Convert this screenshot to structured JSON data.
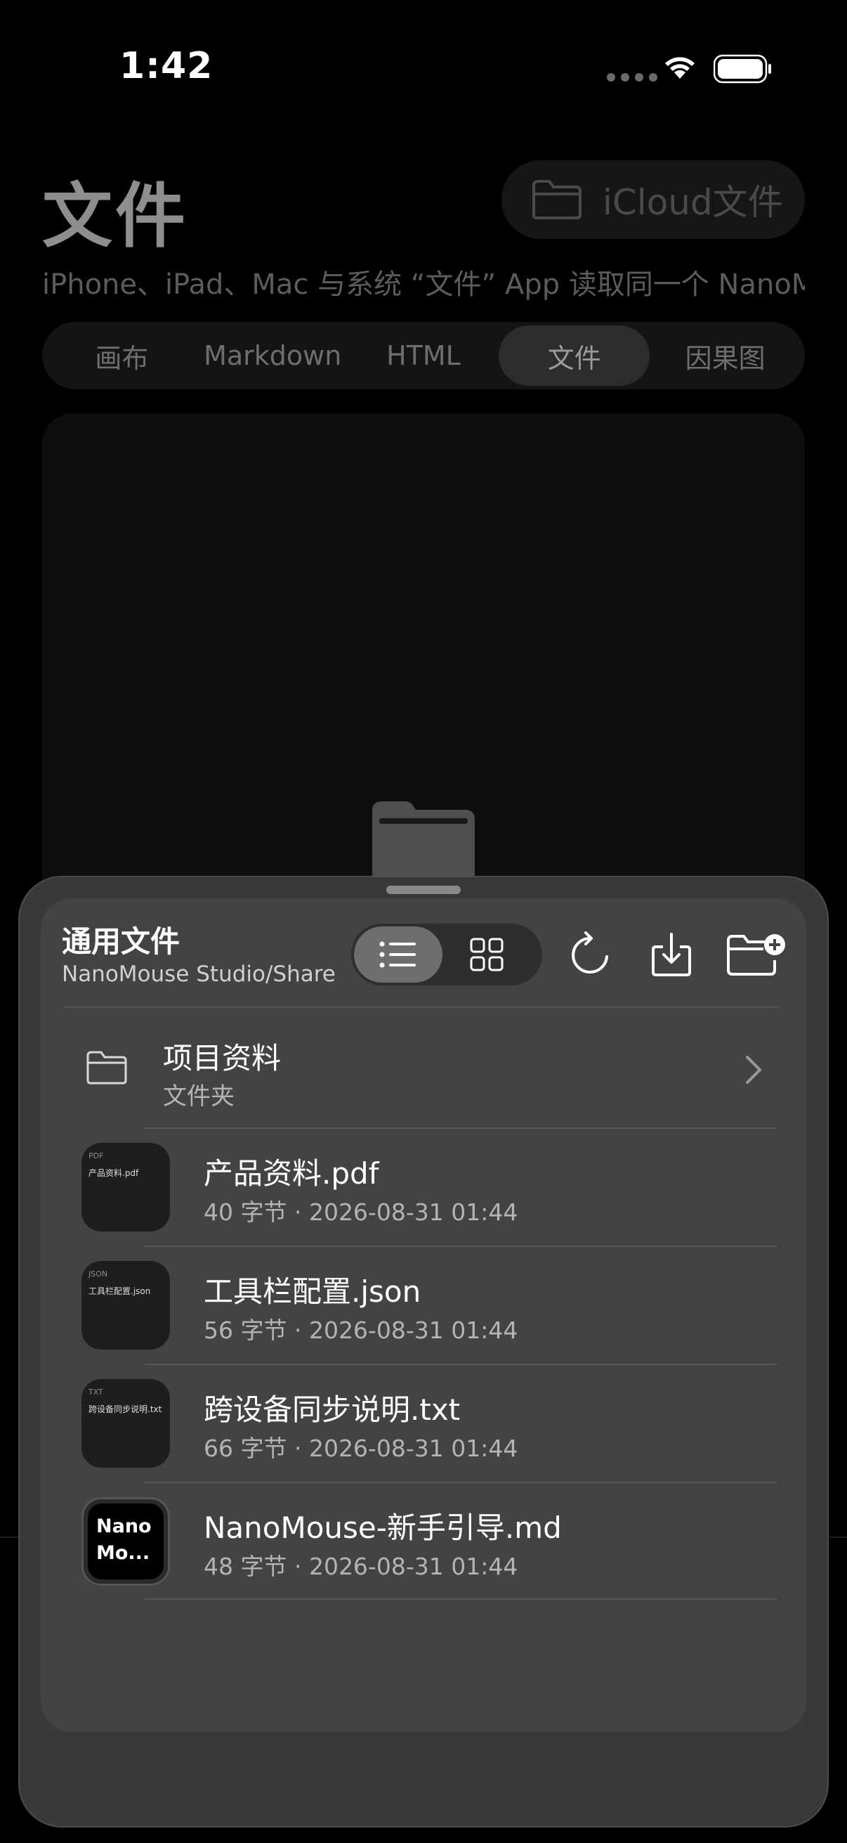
{
  "status": {
    "time": "1:42"
  },
  "header": {
    "title": "文件",
    "icloud_label": "iCloud文件",
    "subtitle": "iPhone、iPad、Mac 与系统 “文件” App 读取同一个 NanoMouse"
  },
  "tabs": [
    {
      "label": "画布"
    },
    {
      "label": "Markdown"
    },
    {
      "label": "HTML"
    },
    {
      "label": "文件",
      "active": true
    },
    {
      "label": "因果图"
    }
  ],
  "sheet": {
    "title": "通用文件",
    "path": "NanoMouse Studio/Share",
    "view_mode": "list",
    "folder": {
      "name": "项目资料",
      "kind": "文件夹"
    },
    "files": [
      {
        "name": "产品资料.pdf",
        "meta": "40 字节 · 2026-08-31 01:44",
        "thumb_type": "PDF",
        "thumb_name": "产品资料.pdf"
      },
      {
        "name": "工具栏配置.json",
        "meta": "56 字节 · 2026-08-31 01:44",
        "thumb_type": "JSON",
        "thumb_name": "工具栏配置.json"
      },
      {
        "name": "跨设备同步说明.txt",
        "meta": "66 字节 · 2026-08-31 01:44",
        "thumb_type": "TXT",
        "thumb_name": "跨设备同步说明.txt"
      },
      {
        "name": "NanoMouse-新手引导.md",
        "meta": "48 字节 · 2026-08-31 01:44",
        "thumb_text_1": "Nano",
        "thumb_text_2": "Mo..."
      }
    ]
  }
}
